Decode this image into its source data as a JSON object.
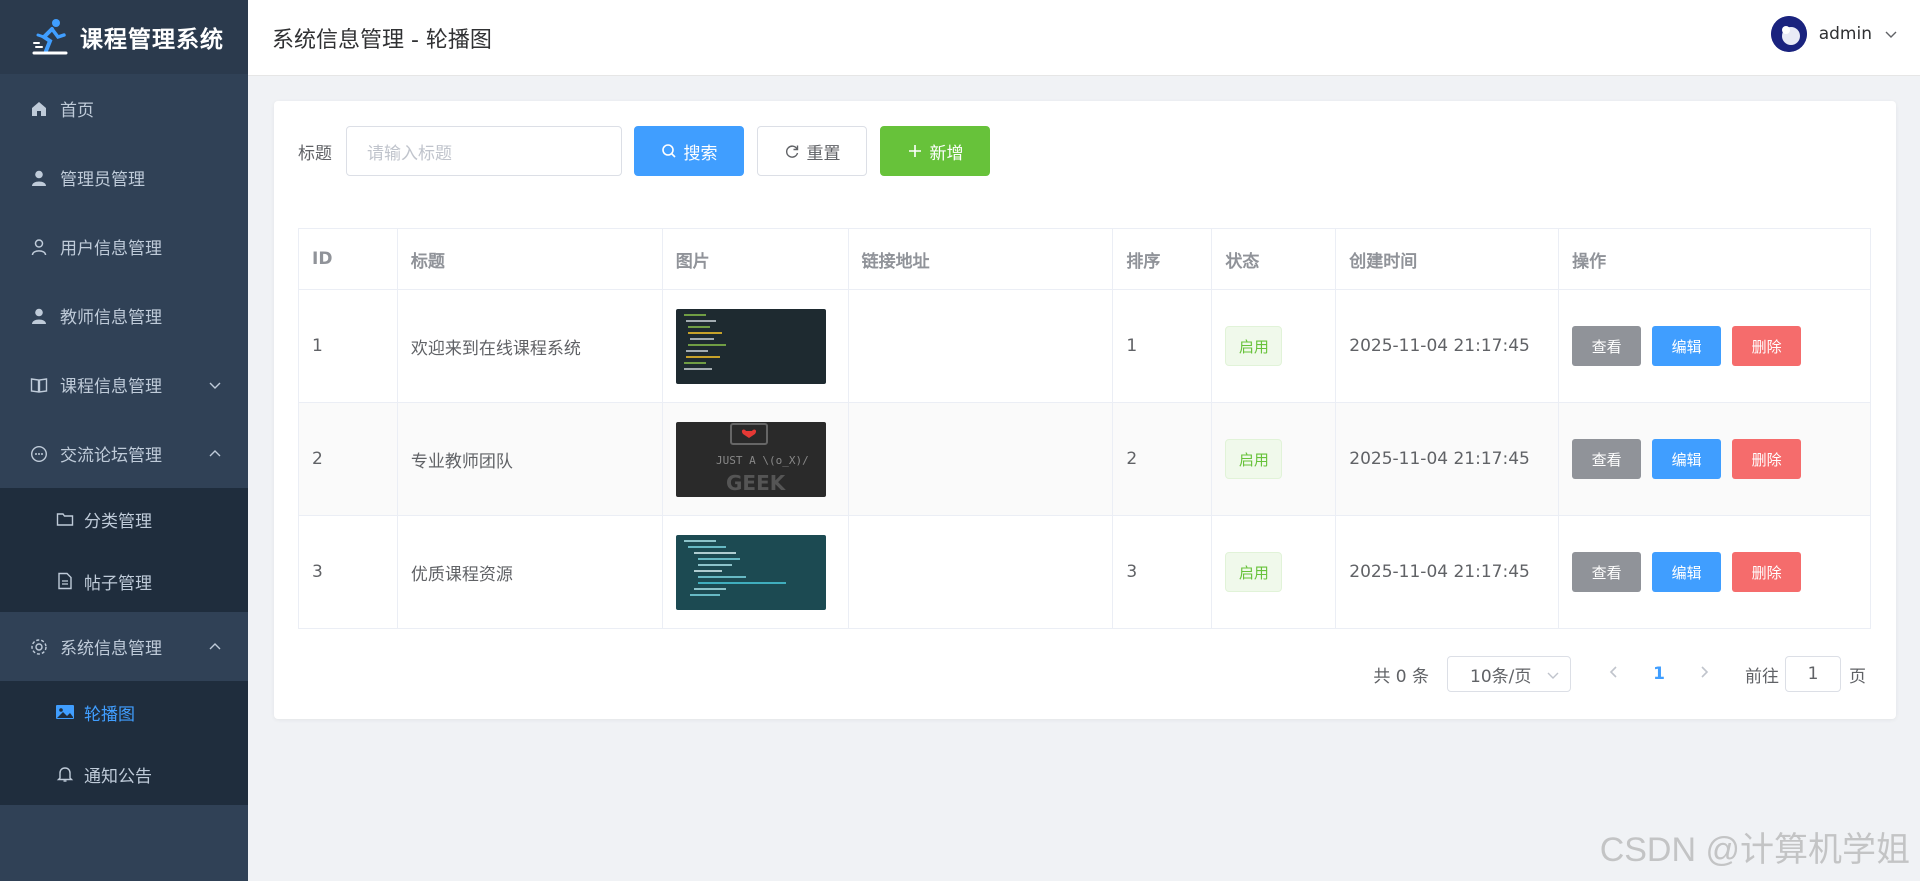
{
  "app": {
    "title": "课程管理系统"
  },
  "sidebar": {
    "items": [
      {
        "label": "首页",
        "icon": "home-icon"
      },
      {
        "label": "管理员管理",
        "icon": "user-solid-icon"
      },
      {
        "label": "用户信息管理",
        "icon": "user-outline-icon"
      },
      {
        "label": "教师信息管理",
        "icon": "user-solid-icon"
      },
      {
        "label": "课程信息管理",
        "icon": "book-icon",
        "expanded": false
      },
      {
        "label": "交流论坛管理",
        "icon": "chat-icon",
        "expanded": true,
        "children": [
          {
            "label": "分类管理",
            "icon": "folder-icon"
          },
          {
            "label": "帖子管理",
            "icon": "document-icon"
          }
        ]
      },
      {
        "label": "系统信息管理",
        "icon": "gear-icon",
        "expanded": true,
        "children": [
          {
            "label": "轮播图",
            "icon": "picture-icon",
            "active": true
          },
          {
            "label": "通知公告",
            "icon": "bell-icon"
          }
        ]
      }
    ]
  },
  "header": {
    "title": "系统信息管理 - 轮播图",
    "username": "admin"
  },
  "search": {
    "label": "标题",
    "placeholder": "请输入标题",
    "search_label": "搜索",
    "reset_label": "重置",
    "add_label": "新增"
  },
  "table": {
    "columns": [
      "ID",
      "标题",
      "图片",
      "链接地址",
      "排序",
      "状态",
      "创建时间",
      "操作"
    ],
    "rows": [
      {
        "id": "1",
        "title": "欢迎来到在线课程系统",
        "link": "",
        "sort": "1",
        "status": "启用",
        "created": "2025-11-04 21:17:45"
      },
      {
        "id": "2",
        "title": "专业教师团队",
        "link": "",
        "sort": "2",
        "status": "启用",
        "created": "2025-11-04 21:17:45"
      },
      {
        "id": "3",
        "title": "优质课程资源",
        "link": "",
        "sort": "3",
        "status": "启用",
        "created": "2025-11-04 21:17:45"
      }
    ],
    "actions": {
      "view": "查看",
      "edit": "编辑",
      "delete": "删除"
    }
  },
  "pagination": {
    "total_text": "共 0 条",
    "page_size": "10条/页",
    "current_page": "1",
    "goto_label": "前往",
    "goto_value": "1",
    "page_suffix": "页"
  },
  "watermark": "CSDN @计算机学姐",
  "colors": {
    "sidebar_bg": "#304156",
    "primary": "#409eff",
    "success": "#67c23a",
    "danger": "#f56c6c",
    "info": "#909399"
  }
}
